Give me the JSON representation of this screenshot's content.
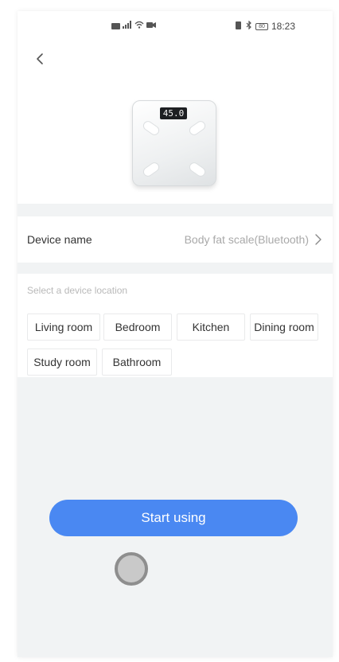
{
  "status_bar": {
    "left_icons": [
      "sim-icon",
      "signal-icon",
      "wifi-icon",
      "camera-icon"
    ],
    "right_icons": [
      "vibrate-icon",
      "bluetooth-icon",
      "battery-icon"
    ],
    "battery_level": "80",
    "time": "18:23"
  },
  "header": {
    "back_icon": "chevron-left-icon",
    "scale_display": "45.0"
  },
  "device": {
    "name_label": "Device name",
    "name_value": "Body fat scale(Bluetooth)"
  },
  "location": {
    "title": "Select a device location",
    "options": [
      "Living room",
      "Bedroom",
      "Kitchen",
      "Dining room",
      "Study room",
      "Bathroom"
    ]
  },
  "actions": {
    "start_label": "Start using"
  },
  "colors": {
    "accent": "#4a88f2",
    "background": "#f1f3f4",
    "card": "#ffffff",
    "muted_text": "#a9a9a9"
  }
}
